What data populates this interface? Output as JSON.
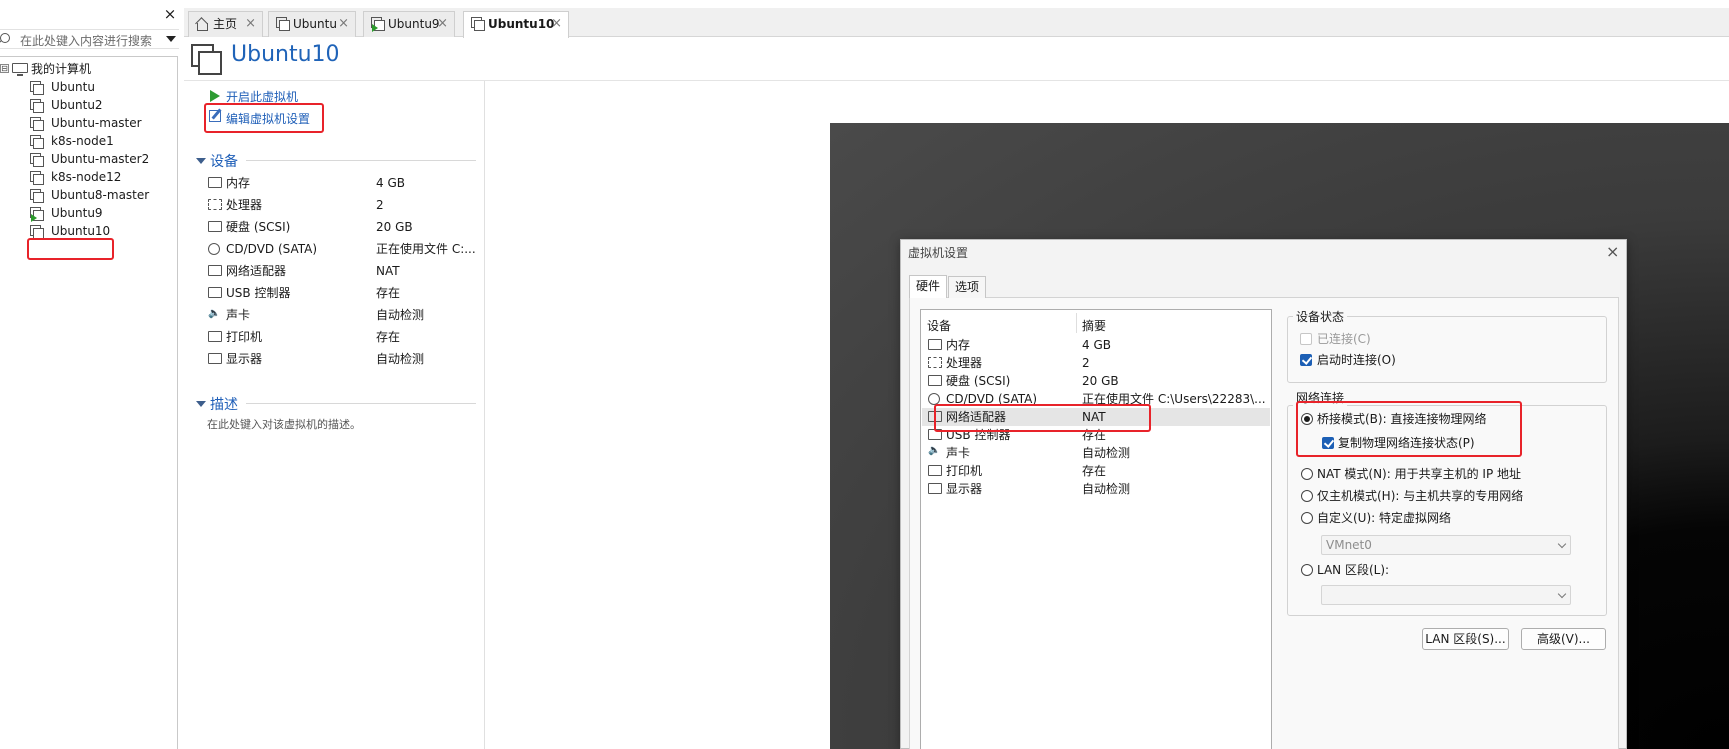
{
  "library": {
    "close_glyph": "×",
    "search_placeholder": "在此处键入内容进行搜索",
    "root": {
      "expander": "⊟",
      "label": "我的计算机"
    },
    "items": [
      {
        "label": "Ubuntu",
        "running": false
      },
      {
        "label": "Ubuntu2",
        "running": false
      },
      {
        "label": "Ubuntu-master",
        "running": false
      },
      {
        "label": "k8s-node1",
        "running": false
      },
      {
        "label": "Ubuntu-master2",
        "running": false
      },
      {
        "label": "k8s-node12",
        "running": false
      },
      {
        "label": "Ubuntu8-master",
        "running": false
      },
      {
        "label": "Ubuntu9",
        "running": true
      },
      {
        "label": "Ubuntu10",
        "running": false,
        "highlighted": true
      }
    ]
  },
  "tabs": [
    {
      "label": "主页",
      "icon": "home-icon",
      "active": false
    },
    {
      "label": "Ubuntu",
      "icon": "vm-icon",
      "active": false
    },
    {
      "label": "Ubuntu9",
      "icon": "vm-running-icon",
      "active": false
    },
    {
      "label": "Ubuntu10",
      "icon": "vm-icon",
      "active": true
    }
  ],
  "tab_close_glyph": "×",
  "vm": {
    "title": "Ubuntu10",
    "actions": {
      "power_on": "开启此虚拟机",
      "edit_settings": "编辑虚拟机设置"
    },
    "devices_header": "设备",
    "devices": [
      {
        "name": "内存",
        "value": "4 GB",
        "icon": "memory-icon"
      },
      {
        "name": "处理器",
        "value": "2",
        "icon": "cpu-icon"
      },
      {
        "name": "硬盘 (SCSI)",
        "value": "20 GB",
        "icon": "hard-disk-icon"
      },
      {
        "name": "CD/DVD (SATA)",
        "value": "正在使用文件 C:...",
        "icon": "cd-icon"
      },
      {
        "name": "网络适配器",
        "value": "NAT",
        "icon": "network-adapter-icon"
      },
      {
        "name": "USB 控制器",
        "value": "存在",
        "icon": "usb-icon"
      },
      {
        "name": "声卡",
        "value": "自动检测",
        "icon": "sound-icon"
      },
      {
        "name": "打印机",
        "value": "存在",
        "icon": "printer-icon"
      },
      {
        "name": "显示器",
        "value": "自动检测",
        "icon": "display-icon"
      }
    ],
    "description_header": "描述",
    "description_placeholder": "在此处键入对该虚拟机的描述。"
  },
  "dialog": {
    "title": "虚拟机设置",
    "close_glyph": "×",
    "tabs": [
      "硬件",
      "选项"
    ],
    "list_headers": {
      "device": "设备",
      "summary": "摘要"
    },
    "hardware": [
      {
        "name": "内存",
        "summary": "4 GB",
        "icon": "memory-icon"
      },
      {
        "name": "处理器",
        "summary": "2",
        "icon": "cpu-icon"
      },
      {
        "name": "硬盘 (SCSI)",
        "summary": "20 GB",
        "icon": "hard-disk-icon"
      },
      {
        "name": "CD/DVD (SATA)",
        "summary": "正在使用文件 C:\\Users\\22283\\...",
        "icon": "cd-icon"
      },
      {
        "name": "网络适配器",
        "summary": "NAT",
        "icon": "network-adapter-icon",
        "selected": true
      },
      {
        "name": "USB 控制器",
        "summary": "存在",
        "icon": "usb-icon"
      },
      {
        "name": "声卡",
        "summary": "自动检测",
        "icon": "sound-icon"
      },
      {
        "name": "打印机",
        "summary": "存在",
        "icon": "printer-icon"
      },
      {
        "name": "显示器",
        "summary": "自动检测",
        "icon": "display-icon"
      }
    ],
    "device_status": {
      "title": "设备状态",
      "connected": {
        "label": "已连接(C)",
        "checked": false,
        "enabled": false
      },
      "connect_at_power_on": {
        "label": "启动时连接(O)",
        "checked": true,
        "enabled": true
      }
    },
    "network_connection": {
      "title": "网络连接",
      "bridged": {
        "label": "桥接模式(B): 直接连接物理网络",
        "selected": true
      },
      "replicate": {
        "label": "复制物理网络连接状态(P)",
        "checked": true
      },
      "nat": {
        "label": "NAT 模式(N): 用于共享主机的 IP 地址",
        "selected": false
      },
      "host_only": {
        "label": "仅主机模式(H): 与主机共享的专用网络",
        "selected": false
      },
      "custom": {
        "label": "自定义(U): 特定虚拟网络",
        "selected": false
      },
      "custom_value": "VMnet0",
      "lan_segment": {
        "label": "LAN 区段(L):",
        "selected": false
      },
      "lan_segment_value": ""
    },
    "buttons": {
      "lan_segments": "LAN 区段(S)...",
      "advanced": "高级(V)..."
    }
  },
  "colors": {
    "highlight": "#e8232a",
    "link": "#1f5fb8",
    "accent": "#1c5fb5"
  }
}
